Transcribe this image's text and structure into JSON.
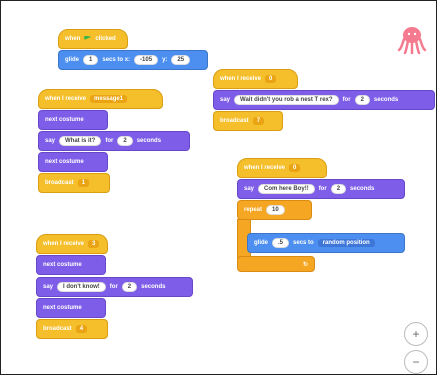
{
  "script1": {
    "hat": "when",
    "hat2": "clicked",
    "glide": "glide",
    "glide_secs": "1",
    "glide_mid": "secs to x:",
    "glide_x": "-105",
    "glide_y_label": "y:",
    "glide_y": "25"
  },
  "script2": {
    "hat": "when I receive",
    "hat_opt": "0",
    "say": "say",
    "say_text": "Wait didn't you rob a nest T rex?",
    "say_for": "for",
    "say_secs": "2",
    "say_unit": "seconds",
    "broadcast": "broadcast",
    "broadcast_opt": "7"
  },
  "script3": {
    "hat": "when I receive",
    "hat_opt": "message1",
    "next1": "next costume",
    "say": "say",
    "say_text": "What is it?",
    "say_for": "for",
    "say_secs": "2",
    "say_unit": "seconds",
    "next2": "next costume",
    "broadcast": "broadcast",
    "broadcast_opt": "1"
  },
  "script4": {
    "hat": "when I receive",
    "hat_opt": "0",
    "say": "say",
    "say_text": "Com here Boy!!",
    "say_for": "for",
    "say_secs": "2",
    "say_unit": "seconds",
    "repeat": "repeat",
    "repeat_n": "10",
    "glide": "glide",
    "glide_secs": ".5",
    "glide_mid": "secs to",
    "glide_opt": "random position",
    "loop_arrow": "↻"
  },
  "script5": {
    "hat": "when I receive",
    "hat_opt": "3",
    "next1": "next costume",
    "say": "say",
    "say_text": "I don't know!",
    "say_for": "for",
    "say_secs": "2",
    "say_unit": "seconds",
    "next2": "next costume",
    "broadcast": "broadcast",
    "broadcast_opt": "4"
  },
  "zoom": {
    "in": "+",
    "out": "−"
  }
}
